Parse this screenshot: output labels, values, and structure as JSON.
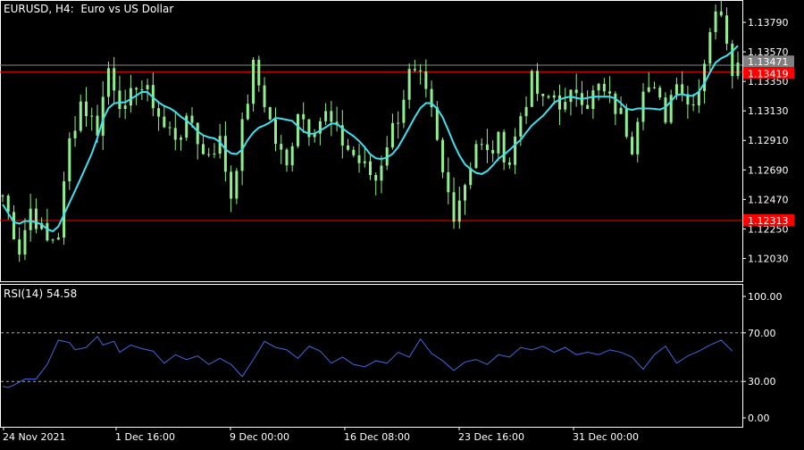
{
  "header": {
    "symbol": "EURUSD",
    "timeframe": "H4",
    "description": "Euro vs US Dollar"
  },
  "price_badges": {
    "current": "1.13471",
    "upper_line": "1.13419",
    "lower_line": "1.12313"
  },
  "rsi": {
    "label": "RSI(14) 54.58",
    "levels": [
      100,
      70,
      30,
      0
    ],
    "level_labels": [
      "100.00",
      "70.00",
      "30.00",
      "0.00"
    ]
  },
  "colors": {
    "background": "#000000",
    "frame": "#ffffff",
    "candles": "#90ee90",
    "ma": "#40e0f0",
    "hline": "#ff0000",
    "rsi_line": "#4169e1",
    "current_badge": "#808080"
  },
  "chart_data": [
    {
      "type": "candlestick",
      "title": "EURUSD, H4:  Euro vs US Dollar",
      "ylim": [
        1.1186,
        1.1395
      ],
      "y_ticks": [
        1.1379,
        1.1357,
        1.1335,
        1.1313,
        1.1291,
        1.1269,
        1.1247,
        1.1225,
        1.1203
      ],
      "y_tick_labels": [
        "1.13790",
        "1.13570",
        "1.13350",
        "1.13130",
        "1.12910",
        "1.12690",
        "1.12470",
        "1.12250",
        "1.12030"
      ],
      "x_labels": [
        "24 Nov 2021",
        "1 Dec 16:00",
        "9 Dec 00:00",
        "16 Dec 08:00",
        "23 Dec 16:00",
        "31 Dec 00:00"
      ],
      "horizontal_lines": [
        1.13419,
        1.12313
      ],
      "current_price": 1.13471,
      "close_path": [
        [
          0,
          1.125
        ],
        [
          3,
          1.121
        ],
        [
          5,
          1.124
        ],
        [
          8,
          1.1215
        ],
        [
          10,
          1.1222
        ],
        [
          12,
          1.129
        ],
        [
          14,
          1.132
        ],
        [
          17,
          1.13
        ],
        [
          19,
          1.1345
        ],
        [
          22,
          1.131
        ],
        [
          24,
          1.1335
        ],
        [
          27,
          1.132
        ],
        [
          29,
          1.13
        ],
        [
          31,
          1.1295
        ],
        [
          34,
          1.1305
        ],
        [
          36,
          1.128
        ],
        [
          39,
          1.129
        ],
        [
          41,
          1.125
        ],
        [
          43,
          1.13
        ],
        [
          45,
          1.1345
        ],
        [
          47,
          1.132
        ],
        [
          49,
          1.129
        ],
        [
          51,
          1.127
        ],
        [
          53,
          1.1315
        ],
        [
          55,
          1.13
        ],
        [
          58,
          1.131
        ],
        [
          60,
          1.1295
        ],
        [
          62,
          1.1285
        ],
        [
          65,
          1.127
        ],
        [
          67,
          1.1262
        ],
        [
          69,
          1.129
        ],
        [
          71,
          1.131
        ],
        [
          73,
          1.134
        ],
        [
          75,
          1.1335
        ],
        [
          77,
          1.131
        ],
        [
          79,
          1.1265
        ],
        [
          81,
          1.1238
        ],
        [
          83,
          1.126
        ],
        [
          85,
          1.129
        ],
        [
          87,
          1.128
        ],
        [
          89,
          1.129
        ],
        [
          91,
          1.1275
        ],
        [
          93,
          1.131
        ],
        [
          95,
          1.1335
        ],
        [
          97,
          1.1318
        ],
        [
          99,
          1.1325
        ],
        [
          101,
          1.1315
        ],
        [
          103,
          1.133
        ],
        [
          105,
          1.132
        ],
        [
          107,
          1.133
        ],
        [
          109,
          1.132
        ],
        [
          111,
          1.131
        ],
        [
          113,
          1.1288
        ],
        [
          115,
          1.1335
        ],
        [
          117,
          1.1325
        ],
        [
          119,
          1.131
        ],
        [
          121,
          1.134
        ],
        [
          123,
          1.1318
        ],
        [
          125,
          1.133
        ],
        [
          127,
          1.1375
        ],
        [
          129,
          1.139
        ],
        [
          131,
          1.1347
        ]
      ]
    },
    {
      "type": "line",
      "title": "RSI(14) 54.58",
      "ylim": [
        0,
        100
      ],
      "y_ticks": [
        100,
        70,
        30,
        0
      ],
      "values": [
        [
          0,
          26
        ],
        [
          1,
          25
        ],
        [
          2,
          27
        ],
        [
          4,
          32
        ],
        [
          6,
          32
        ],
        [
          8,
          44
        ],
        [
          10,
          64
        ],
        [
          12,
          62
        ],
        [
          13,
          56
        ],
        [
          15,
          58
        ],
        [
          17,
          67
        ],
        [
          18,
          60
        ],
        [
          20,
          63
        ],
        [
          21,
          54
        ],
        [
          23,
          60
        ],
        [
          25,
          57
        ],
        [
          27,
          55
        ],
        [
          29,
          45
        ],
        [
          31,
          52
        ],
        [
          33,
          48
        ],
        [
          35,
          51
        ],
        [
          37,
          44
        ],
        [
          39,
          49
        ],
        [
          41,
          44
        ],
        [
          43,
          34
        ],
        [
          45,
          48
        ],
        [
          47,
          63
        ],
        [
          49,
          58
        ],
        [
          51,
          56
        ],
        [
          53,
          49
        ],
        [
          55,
          59
        ],
        [
          57,
          55
        ],
        [
          59,
          45
        ],
        [
          61,
          50
        ],
        [
          63,
          44
        ],
        [
          65,
          42
        ],
        [
          67,
          47
        ],
        [
          69,
          45
        ],
        [
          71,
          54
        ],
        [
          73,
          50
        ],
        [
          75,
          65
        ],
        [
          77,
          53
        ],
        [
          79,
          47
        ],
        [
          81,
          39
        ],
        [
          83,
          46
        ],
        [
          85,
          48
        ],
        [
          87,
          44
        ],
        [
          89,
          52
        ],
        [
          91,
          50
        ],
        [
          93,
          58
        ],
        [
          95,
          56
        ],
        [
          97,
          59
        ],
        [
          99,
          54
        ],
        [
          101,
          58
        ],
        [
          103,
          52
        ],
        [
          105,
          54
        ],
        [
          107,
          52
        ],
        [
          109,
          56
        ],
        [
          111,
          54
        ],
        [
          113,
          50
        ],
        [
          115,
          40
        ],
        [
          117,
          52
        ],
        [
          119,
          59
        ],
        [
          121,
          45
        ],
        [
          123,
          51
        ],
        [
          125,
          55
        ],
        [
          127,
          60
        ],
        [
          129,
          64
        ],
        [
          131,
          55
        ]
      ]
    }
  ]
}
